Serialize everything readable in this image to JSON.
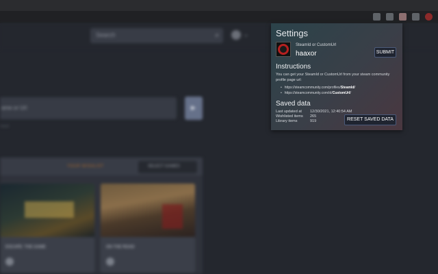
{
  "browser": {
    "extensions": [
      "puzzle-icon",
      "extension-icon",
      "extension-icon",
      "steam-extension-icon",
      "profile-icon"
    ]
  },
  "background_page": {
    "search_placeholder": "Search",
    "search_icon": "search-icon",
    "user_caret": "⌄",
    "form_text": "ame or Url",
    "tiny_text": "ment",
    "orange_link": "YOUR WISHLIST",
    "select_button": "SELECT GAMES",
    "cards": [
      {
        "title": "ESCAPE: THE GAME"
      },
      {
        "title": "ON THE ROAD"
      }
    ],
    "arrow": "▶"
  },
  "settings": {
    "title": "Settings",
    "steamid_label": "SteamId or CustomUrl",
    "steamid_value": "haaxor",
    "submit_label": "SUBMIT",
    "instructions_title": "Instructions",
    "instructions_text": "You can get your SteamId or CustomUrl from your steam community profile page url:",
    "urls": [
      {
        "prefix": "https://steamcommunity.com/profiles/",
        "bold": "SteamId",
        "suffix": "/"
      },
      {
        "prefix": "https://steamcommunity.com/id/",
        "bold": "CustomUrl",
        "suffix": "/"
      }
    ],
    "saved_title": "Saved data",
    "saved_rows": [
      {
        "key": "Last updated at",
        "value": "12/30/2021, 12:40:54 AM"
      },
      {
        "key": "Wishlisted items",
        "value": "265"
      },
      {
        "key": "Library items",
        "value": "919"
      }
    ],
    "reset_label": "RESET SAVED DATA"
  }
}
